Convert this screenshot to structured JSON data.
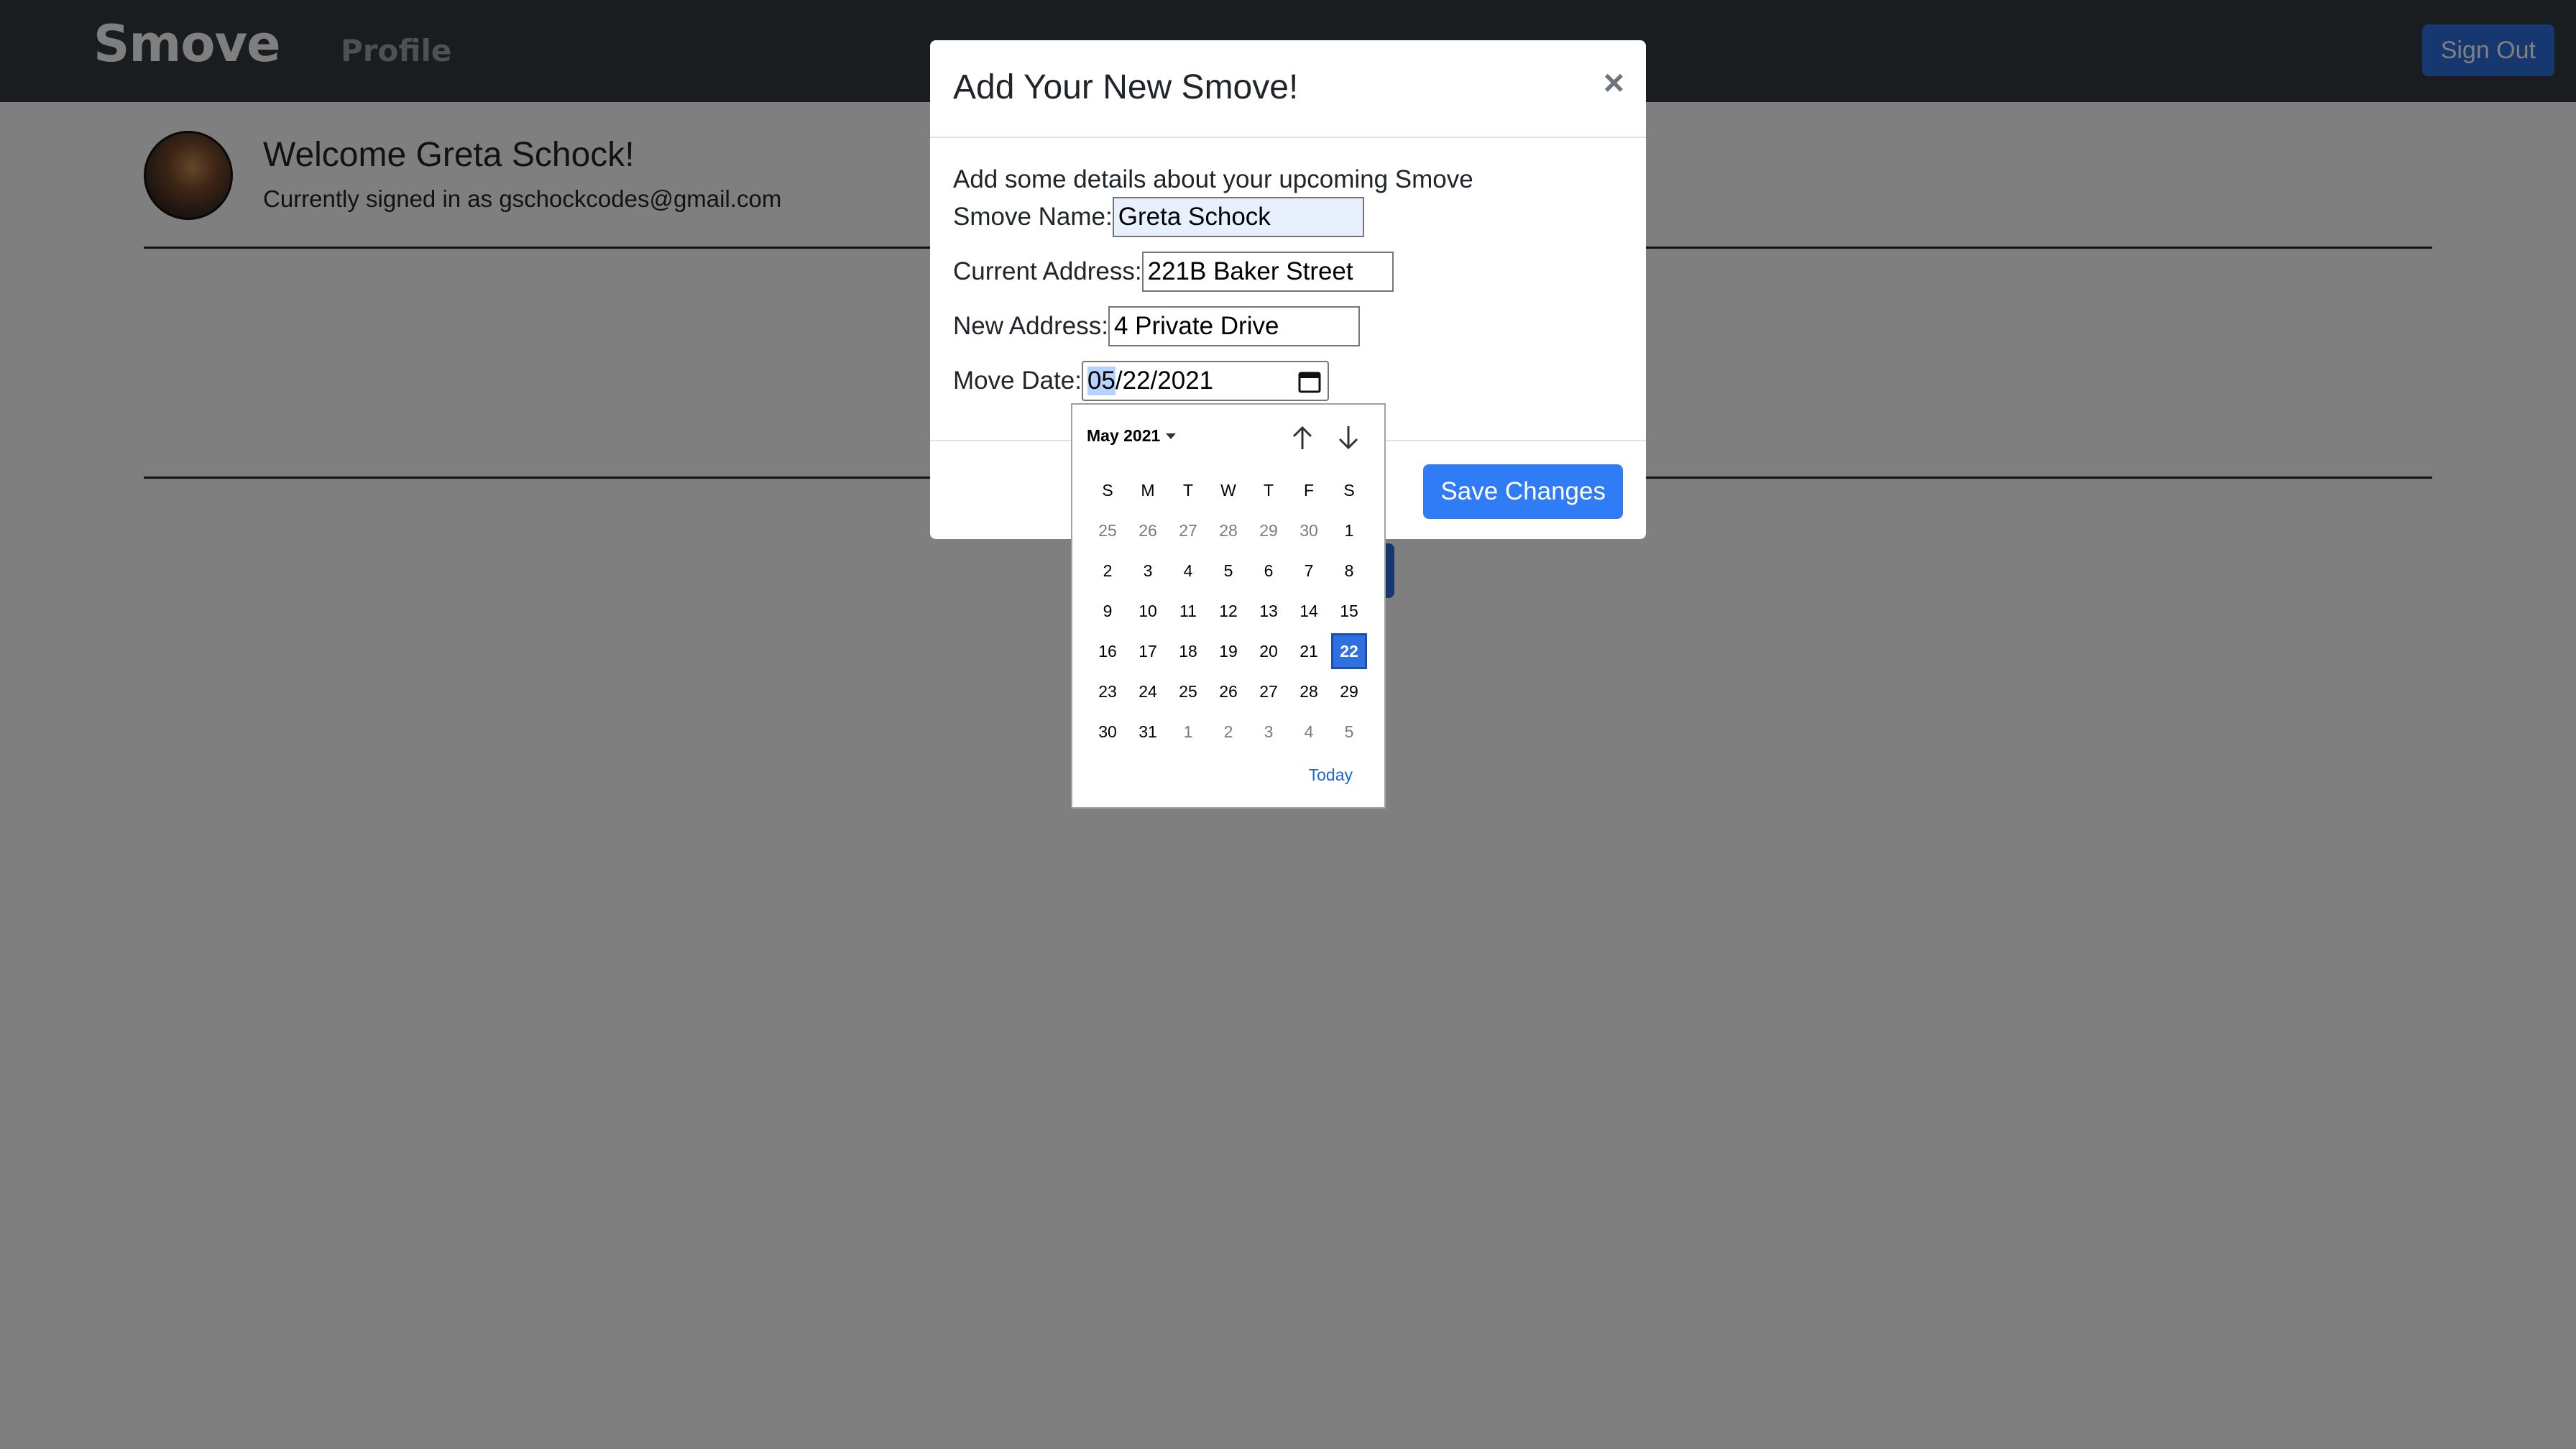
{
  "navbar": {
    "brand": "Smove",
    "profile_link": "Profile",
    "signout_label": "Sign Out"
  },
  "profile": {
    "welcome": "Welcome Greta Schock!",
    "signed_in": "Currently signed in as gschockcodes@gmail.com"
  },
  "modal": {
    "title": "Add Your New Smove!",
    "close": "×",
    "intro": "Add some details about your upcoming Smove",
    "fields": {
      "name_label": "Smove Name:",
      "name_value": "Greta Schock",
      "current_label": "Current Address:",
      "current_value": "221B Baker Street",
      "new_label": "New Address:",
      "new_value": "4 Private Drive",
      "date_label": "Move Date:",
      "date_month": "05",
      "date_rest": "/22/2021"
    },
    "save_label": "Save Changes"
  },
  "datepicker": {
    "month_label": "May 2021",
    "weekdays": [
      "S",
      "M",
      "T",
      "W",
      "T",
      "F",
      "S"
    ],
    "weeks": [
      [
        {
          "d": "25",
          "m": true
        },
        {
          "d": "26",
          "m": true
        },
        {
          "d": "27",
          "m": true
        },
        {
          "d": "28",
          "m": true
        },
        {
          "d": "29",
          "m": true
        },
        {
          "d": "30",
          "m": true
        },
        {
          "d": "1"
        }
      ],
      [
        {
          "d": "2"
        },
        {
          "d": "3"
        },
        {
          "d": "4"
        },
        {
          "d": "5"
        },
        {
          "d": "6"
        },
        {
          "d": "7"
        },
        {
          "d": "8"
        }
      ],
      [
        {
          "d": "9"
        },
        {
          "d": "10"
        },
        {
          "d": "11"
        },
        {
          "d": "12"
        },
        {
          "d": "13"
        },
        {
          "d": "14"
        },
        {
          "d": "15"
        }
      ],
      [
        {
          "d": "16"
        },
        {
          "d": "17"
        },
        {
          "d": "18"
        },
        {
          "d": "19"
        },
        {
          "d": "20"
        },
        {
          "d": "21"
        },
        {
          "d": "22",
          "s": true
        }
      ],
      [
        {
          "d": "23"
        },
        {
          "d": "24"
        },
        {
          "d": "25"
        },
        {
          "d": "26"
        },
        {
          "d": "27"
        },
        {
          "d": "28"
        },
        {
          "d": "29"
        }
      ],
      [
        {
          "d": "30"
        },
        {
          "d": "31"
        },
        {
          "d": "1",
          "m": true
        },
        {
          "d": "2",
          "m": true
        },
        {
          "d": "3",
          "m": true
        },
        {
          "d": "4",
          "m": true
        },
        {
          "d": "5",
          "m": true
        }
      ]
    ],
    "today_label": "Today"
  },
  "colors": {
    "navbar": "#343a40",
    "primary": "#2f7cf6",
    "selected_day": "#2f6fe0"
  }
}
